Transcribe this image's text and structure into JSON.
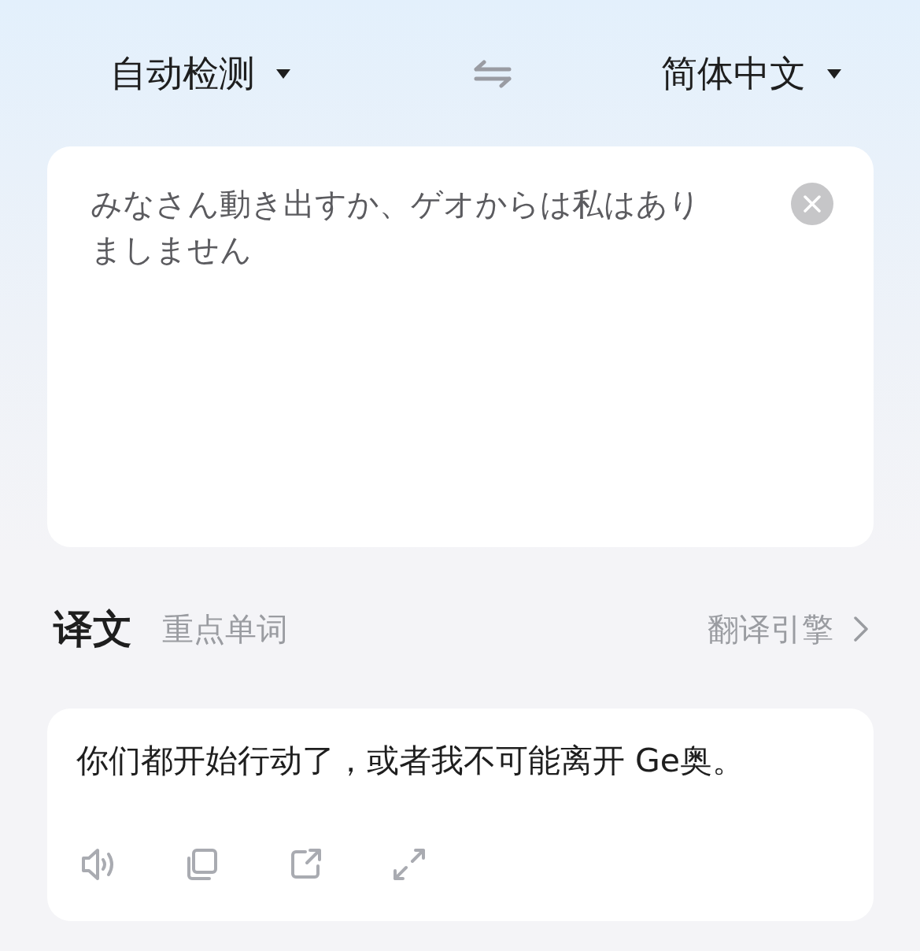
{
  "language_bar": {
    "source_language": "自动检测",
    "target_language": "简体中文"
  },
  "input": {
    "value": "みなさん動き出すか、ゲオからは私はありましません"
  },
  "result_tabs": [
    {
      "label": "译文",
      "selected": true
    },
    {
      "label": "重点单词",
      "selected": false
    }
  ],
  "engine_link": "翻译引擎",
  "output": {
    "text": "你们都开始行动了，或者我不可能离开 Ge奥。",
    "actions": [
      {
        "kind": "speak"
      },
      {
        "kind": "copy"
      },
      {
        "kind": "share"
      },
      {
        "kind": "expand"
      }
    ]
  }
}
